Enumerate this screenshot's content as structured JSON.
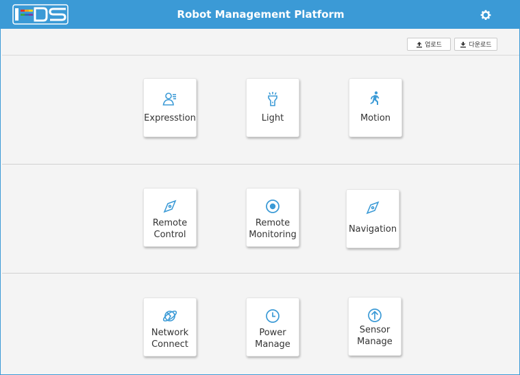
{
  "header": {
    "logo_text": "NDS",
    "title": "Robot Management Platform",
    "settings_icon": "gear-icon",
    "color": "#3b9ad6"
  },
  "toolbar": {
    "upload_label": "업로드",
    "download_label": "다운로드"
  },
  "sections": [
    {
      "cards": [
        {
          "label": "Expresstion",
          "icon": "person-icon"
        },
        {
          "label": "Light",
          "icon": "flashlight-icon"
        },
        {
          "label": "Motion",
          "icon": "running-person-icon"
        }
      ]
    },
    {
      "cards": [
        {
          "label_line1": "Remote",
          "label_line2": "Control",
          "icon": "compass-icon"
        },
        {
          "label_line1": "Remote",
          "label_line2": "Monitoring",
          "icon": "target-icon"
        },
        {
          "label": "Navigation",
          "icon": "compass-icon"
        }
      ]
    },
    {
      "cards": [
        {
          "label_line1": "Network",
          "label_line2": "Connect",
          "icon": "globe-icon"
        },
        {
          "label_line1": "Power",
          "label_line2": "Manage",
          "icon": "clock-icon"
        },
        {
          "label_line1": "Sensor",
          "label_line2": "Manage",
          "icon": "arrow-up-circle-icon"
        }
      ]
    }
  ]
}
